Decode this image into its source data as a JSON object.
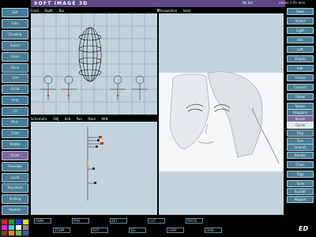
{
  "app": {
    "title": "SOFT IMAGE 3D",
    "file": "No Sel",
    "extra": "model-1 Ptr bleh"
  },
  "left_buttons": [
    "Get",
    "Info",
    "Drawing",
    "Select",
    "Clone",
    "Dock",
    "Ctrl",
    "Gr.SR",
    "Amp",
    "Ctl",
    "Pick",
    "Cmd",
    "Rotate",
    "Scale",
    "Translate",
    "Local",
    "Transform",
    "Scaling",
    "Position"
  ],
  "right_buttons": [
    "Save",
    "Select",
    "Light",
    "Info",
    "Loft",
    "Shapes",
    "Edit",
    "Freeze",
    "Convert",
    "Global",
    "Nodes",
    "Polygons",
    "Resize",
    "Curve",
    "Disp",
    "Trim",
    "Smooth",
    "Render",
    "Chain",
    "Tags",
    "Tools",
    "Ex.Edit",
    "Magnet"
  ],
  "viewports": {
    "top_left": {
      "labels": [
        "Front",
        "Right",
        "Top"
      ]
    },
    "top_right": {
      "labels": [
        "Perspective",
        "Solid"
      ]
    },
    "bottom_left": {
      "labels": [
        "Schematic",
        "OBJ",
        "Edit",
        "Pan",
        "More",
        "WIN"
      ]
    }
  },
  "bottom_bar": {
    "items": [
      "ANIM",
      "ZOOM",
      "PAN",
      "ROT",
      "KEY",
      "SEL",
      "CUT",
      "COPY",
      "PASTE",
      "GRID"
    ]
  },
  "palette_colors": [
    "#e02020",
    "#20a020",
    "#2040e0",
    "#e0e020",
    "#e020e0",
    "#20e0e0",
    "#ffffff",
    "#888888",
    "#804020",
    "#ff8000",
    "#60c060",
    "#4060a0"
  ],
  "logo": "ED"
}
